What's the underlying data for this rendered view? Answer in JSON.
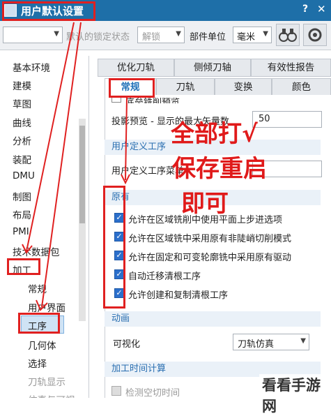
{
  "window": {
    "title": "用户默认设置",
    "help": "?",
    "close": "✕"
  },
  "toolbar": {
    "lock_state_label": "默认的锁定状态",
    "lock_state_value": "解锁",
    "unit_label": "部件单位",
    "unit_value": "毫米"
  },
  "tree": {
    "items": [
      "基本环境",
      "建模",
      "草图",
      "曲线",
      "分析",
      "装配",
      "DMU",
      "制图",
      "布局",
      "PMI",
      "技术数据包",
      "加工"
    ],
    "sub_items": [
      "常规",
      "用户界面",
      "工序",
      "几何体",
      "选择",
      "刀轨显示",
      "仿真与可视"
    ]
  },
  "tabs_row1": [
    "优化刀轨",
    "侧倾刀轴",
    "有效性报告"
  ],
  "tabs_row2": [
    "常规",
    "刀轨",
    "变换",
    "颜色"
  ],
  "panel": {
    "top_option": "底垒铣削预览",
    "preview_label": "投影预览 - 显示的最大矢量数",
    "preview_value": "50",
    "user_tool_section": "用户定义工序",
    "user_tool_label": "用户定义工序菜单",
    "original_section": "原有",
    "checkboxes": [
      "允许在区域铣削中使用平面上步进选项",
      "允许在区域铣中采用原有非陡峭切削模式",
      "允许在固定和可变轮廓铣中采用原有驱动",
      "自动迁移清根工序",
      "允许创建和复制清根工序"
    ],
    "animation_section": "动画",
    "visualize_label": "可视化",
    "visualize_value": "刀轨仿真",
    "time_section": "加工时间计算",
    "gouge_check": "检测空切时间"
  },
  "annotation": {
    "line1": "全部打√",
    "line2": "保存重启",
    "line3": "即可"
  },
  "watermark": "看看手游网",
  "colors": {
    "accent": "#1e6fa8",
    "annotation_red": "#e02020"
  }
}
